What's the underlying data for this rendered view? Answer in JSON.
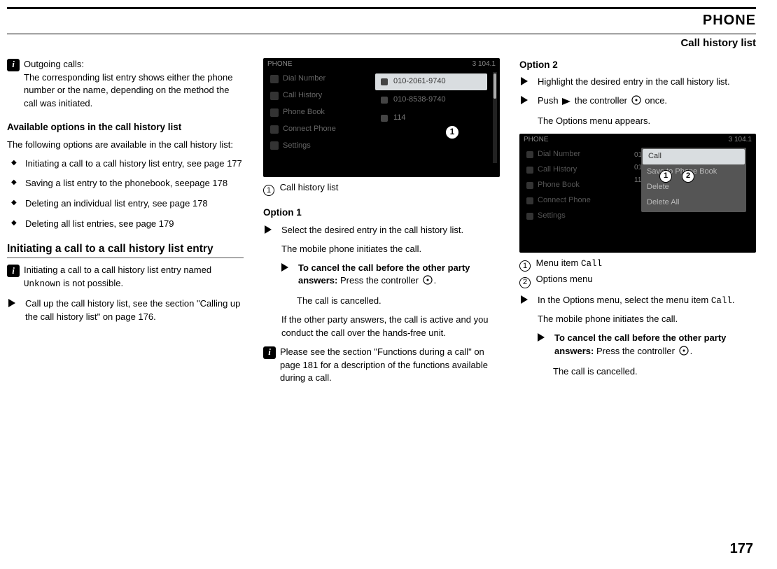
{
  "header": {
    "title": "PHONE",
    "subtitle": "Call history list"
  },
  "col1": {
    "note1_label": "Outgoing calls:",
    "note1_body": "The corresponding list entry shows either the phone number or the name, depending on the method the call was initiated.",
    "sec1_title": "Available options in the call history list",
    "sec1_intro": "The following options are available in the call history list:",
    "bullets": [
      "Initiating a call to a call history list entry, see page 177",
      "Saving a list entry to the phonebook, seepage 178",
      "Deleting an individual list entry, see page 178",
      "Deleting all list entries, see page 179"
    ],
    "sec2_title": "Initiating a call to a call history list entry",
    "note2_pre": "Initiating a call to a call history list entry named ",
    "note2_unknown": "Unknown",
    "note2_post": " is not possible.",
    "step1": "Call up the call history list, see the section \"Calling up the call history list\" on page 176."
  },
  "col2": {
    "ss1": {
      "top_left": "PHONE",
      "top_right": "3   104.1",
      "left_items": [
        "Dial Number",
        "Call History",
        "Phone Book",
        "Connect Phone",
        "Settings"
      ],
      "right_entries": [
        "010-2061-9740",
        "010-8538-9740",
        "114"
      ]
    },
    "legend1_label": "Call history list",
    "option1_title": "Option 1",
    "step1": "Select the desired entry in the call history list.",
    "step1_result": "The mobile phone initiates the call.",
    "sub_bold": "To cancel the call before the other party answers:",
    "sub_tail": " Press the controller ",
    "sub_tail2": ".",
    "sub_result": "The call is cancelled.",
    "after1": "If the other party answers, the call is active and you conduct the call over the hands-free unit.",
    "note3": "Please see the section \"Functions during a call\" on page 181 for a description of the functions available during a call."
  },
  "col3": {
    "option2_title": "Option 2",
    "step1": "Highlight the desired entry in the call history list.",
    "step2_pre": "Push ",
    "step2_mid": " the controller ",
    "step2_post": " once.",
    "step2_result": "The Options menu appears.",
    "ss2": {
      "top_left": "PHONE",
      "top_right": "3   104.1",
      "left_items": [
        "Dial Number",
        "Call History",
        "Phone Book",
        "Connect Phone",
        "Settings"
      ],
      "nums": [
        "01",
        "01",
        "11"
      ],
      "popup": [
        "Call",
        "Save to Phone Book",
        "Delete",
        "Delete All"
      ]
    },
    "legend1_pre": "Menu item ",
    "legend1_item": "Call",
    "legend2": "Options menu",
    "step3_pre": "In the Options menu, select the menu item ",
    "step3_item": "Call",
    "step3_post": ".",
    "step3_result": "The mobile phone initiates the call.",
    "sub_bold": "To cancel the call before the other party answers:",
    "sub_tail": " Press the controller ",
    "sub_tail2": ".",
    "sub_result": "The call is cancelled."
  },
  "page_number": "177"
}
